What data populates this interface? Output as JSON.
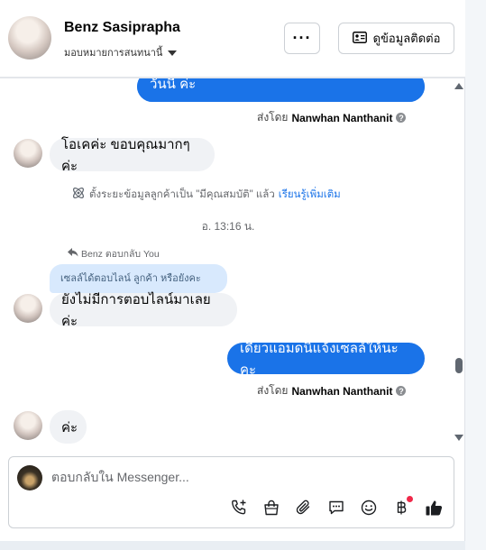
{
  "header": {
    "contact_name": "Benz Sasiprapha",
    "assign_label": "มอบหมายการสนทนานี้",
    "more_label": "···",
    "contact_info_label": "ดูข้อมูลติดต่อ"
  },
  "messages": {
    "out_1_text": "วันนี้ ค่ะ",
    "sent_by_1_prefix": "ส่งโดย",
    "sent_by_1_name": "Nanwhan Nanthanit",
    "in_1_text": "โอเคค่ะ ขอบคุณมากๆค่ะ",
    "system_text": "ตั้งระยะข้อมูลลูกค้าเป็น \"มีคุณสมบัติ\" แล้ว",
    "system_link": "เรียนรู้เพิ่มเติม",
    "timestamp": "อ. 13:16 น.",
    "replied_to": "Benz ตอบกลับ You",
    "quoted_text": "เซลล์ได้ตอบไลน์ ลูกค้า หรือยังคะ",
    "in_2_text": "ยังไม่มีการตอบไลน์มาเลยค่ะ",
    "out_2_text": "เดี๋ยวแอมดนิแจ้งเซลล์ให้นะคะ",
    "sent_by_2_prefix": "ส่งโดย",
    "sent_by_2_name": "Nanwhan Nanthanit",
    "in_3_text": "ค่ะ"
  },
  "composer": {
    "placeholder": "ตอบกลับใน Messenger...",
    "value": ""
  },
  "toolbar_icons": [
    "phone-plus-icon",
    "shopping-bag-icon",
    "paperclip-icon",
    "saved-reply-icon",
    "emoji-icon",
    "baht-payment-icon",
    "like-icon"
  ],
  "colors": {
    "accent": "#1a73e8",
    "incoming_bubble": "#f0f2f5",
    "quoted_bubble": "#d8e9fd",
    "notification_dot": "#f02849"
  }
}
